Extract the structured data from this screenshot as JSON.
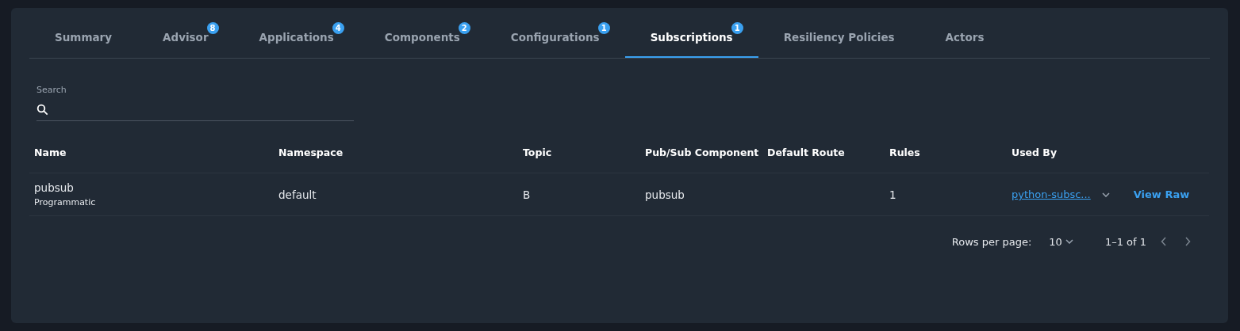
{
  "tabs": [
    {
      "label": "Summary",
      "selected": false
    },
    {
      "label": "Advisor",
      "badge": "8",
      "selected": false
    },
    {
      "label": "Applications",
      "badge": "4",
      "selected": false
    },
    {
      "label": "Components",
      "badge": "2",
      "selected": false
    },
    {
      "label": "Configurations",
      "badge": "1",
      "selected": false
    },
    {
      "label": "Subscriptions",
      "badge": "1",
      "selected": true
    },
    {
      "label": "Resiliency Policies",
      "selected": false
    },
    {
      "label": "Actors",
      "selected": false
    }
  ],
  "search": {
    "label": "Search"
  },
  "table": {
    "columns": [
      "Name",
      "Namespace",
      "Topic",
      "Pub/Sub Component",
      "Default Route",
      "Rules",
      "Used By"
    ],
    "rows": [
      {
        "name": "pubsub",
        "type": "Programmatic",
        "namespace": "default",
        "topic": "B",
        "component": "pubsub",
        "rules": "1",
        "used_by": "python-subsc...",
        "action": "View Raw"
      }
    ]
  },
  "pagination": {
    "rows_label": "Rows per page:",
    "rows_value": "10",
    "range": "1–1 of 1"
  }
}
